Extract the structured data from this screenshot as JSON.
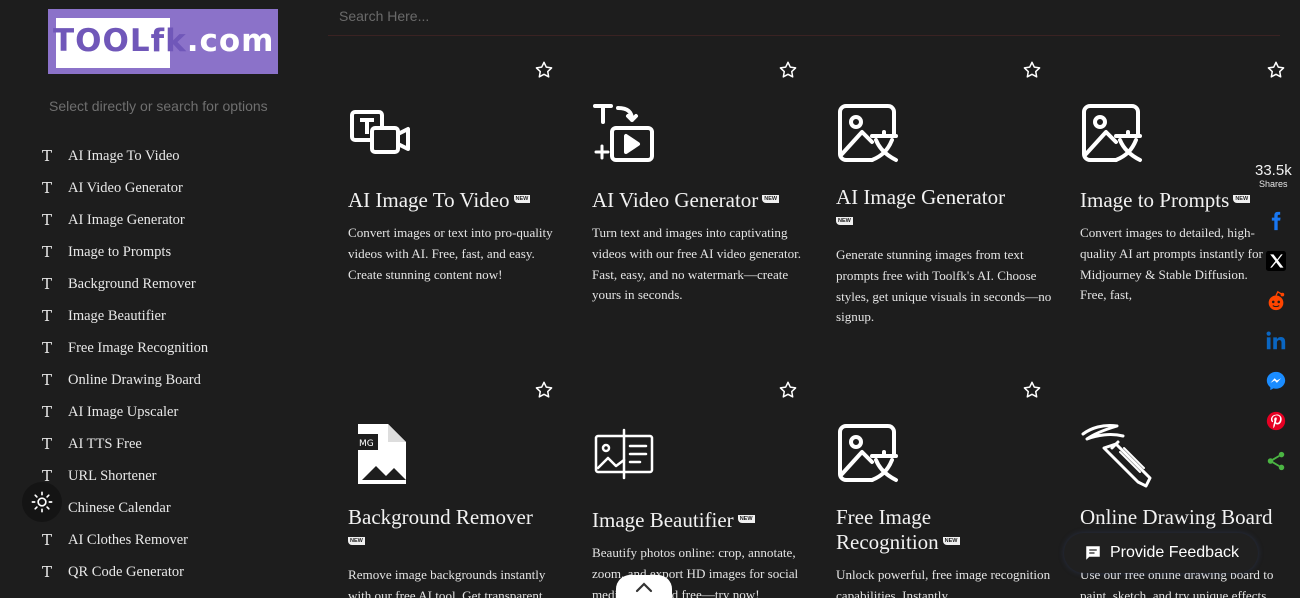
{
  "logo": {
    "brand_main": "TOOLfk",
    "brand_tld": ".com"
  },
  "sidebar": {
    "search_placeholder": "Select directly or search for options",
    "items": [
      {
        "label": "AI Image To Video"
      },
      {
        "label": "AI Video Generator"
      },
      {
        "label": "AI Image Generator"
      },
      {
        "label": "Image to Prompts"
      },
      {
        "label": "Background Remover"
      },
      {
        "label": "Image Beautifier"
      },
      {
        "label": "Free Image Recognition"
      },
      {
        "label": "Online Drawing Board"
      },
      {
        "label": "AI Image Upscaler"
      },
      {
        "label": "AI TTS Free"
      },
      {
        "label": "URL Shortener"
      },
      {
        "label": "Chinese Calendar"
      },
      {
        "label": "AI Clothes Remover"
      },
      {
        "label": "QR Code Generator"
      }
    ],
    "item_icon_glyph": "T"
  },
  "top_search": {
    "placeholder": "Search Here..."
  },
  "badge_text": "NEW",
  "cards": [
    {
      "title": "AI Image To Video",
      "icon": "text-to-video-icon",
      "desc": "Convert images or text into pro-quality videos with AI. Free, fast, and easy. Create stunning content now!"
    },
    {
      "title": "AI Video Generator",
      "icon": "ai-video-generator-icon",
      "desc": "Turn text and images into captivating videos with our free AI video generator. Fast, easy, and no watermark—create yours in seconds."
    },
    {
      "title": "AI Image Generator",
      "icon": "image-translate-icon",
      "desc": "Generate stunning images from text prompts free with Toolfk's AI. Choose styles, get unique visuals in seconds—no signup."
    },
    {
      "title": "Image to Prompts",
      "icon": "image-translate-icon",
      "desc": "Convert images to detailed, high-quality AI art prompts instantly for Midjourney & Stable Diffusion. Free, fast,"
    },
    {
      "title": "Background Remover",
      "icon": "image-file-icon",
      "desc": "Remove image backgrounds instantly with our free AI tool. Get transparent"
    },
    {
      "title": "Image Beautifier",
      "icon": "image-beautifier-icon",
      "desc": "Beautify photos online: crop, annotate, zoom, and export HD images for social media—fast and free—try now!"
    },
    {
      "title": "Free Image Recognition",
      "icon": "image-translate-icon",
      "desc": "Unlock powerful, free image recognition capabilities. Instantly"
    },
    {
      "title": "Online Drawing Board",
      "icon": "drawing-pencil-icon",
      "desc": "Use our free online drawing board to paint, sketch, and try unique effects"
    }
  ],
  "share": {
    "count": "33.5k",
    "label": "Shares",
    "colors": {
      "facebook": "#1877f2",
      "x": "#ffffff",
      "reddit": "#ff4500",
      "linkedin": "#0a66c2",
      "messenger": "#1a8cff",
      "pinterest": "#e60023",
      "sharethis": "#4bb543"
    }
  },
  "feedback": {
    "label": "Provide Feedback"
  }
}
